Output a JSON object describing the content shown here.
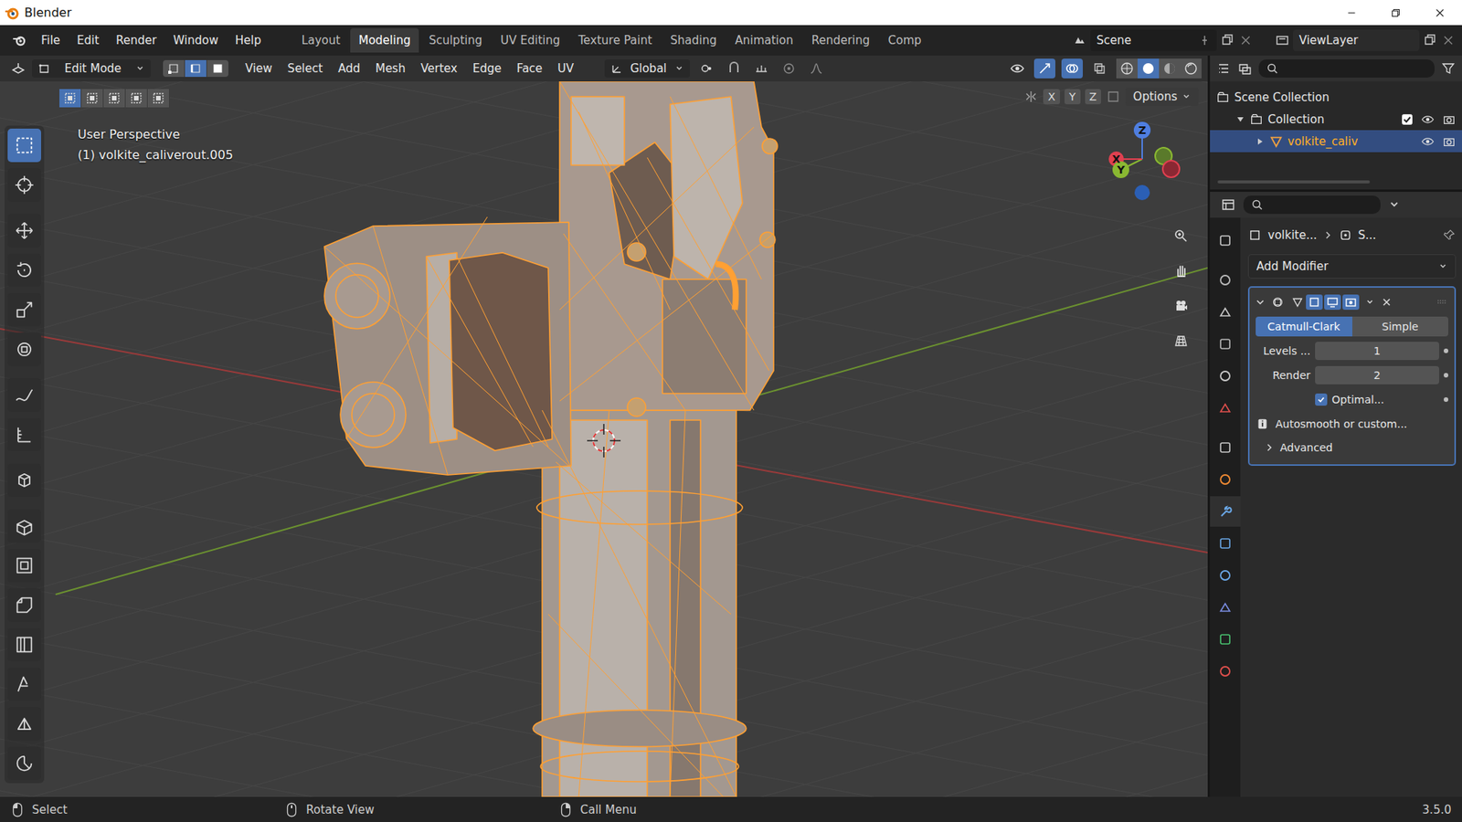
{
  "window": {
    "title": "Blender"
  },
  "menus": [
    "File",
    "Edit",
    "Render",
    "Window",
    "Help"
  ],
  "workspaces": [
    {
      "label": "Layout",
      "selected": false
    },
    {
      "label": "Modeling",
      "selected": true
    },
    {
      "label": "Sculpting",
      "selected": false
    },
    {
      "label": "UV Editing",
      "selected": false
    },
    {
      "label": "Texture Paint",
      "selected": false
    },
    {
      "label": "Shading",
      "selected": false
    },
    {
      "label": "Animation",
      "selected": false
    },
    {
      "label": "Rendering",
      "selected": false
    },
    {
      "label": "Comp",
      "selected": false
    }
  ],
  "scene": "Scene",
  "view_layer": "ViewLayer",
  "header": {
    "mode": "Edit Mode",
    "select_modes": [
      {
        "selected": false
      },
      {
        "selected": true
      },
      {
        "selected": false
      }
    ],
    "menus": [
      "View",
      "Select",
      "Add",
      "Mesh",
      "Vertex",
      "Edge",
      "Face",
      "UV"
    ],
    "orientation": "Global",
    "shading": [
      {
        "selected": false
      },
      {
        "selected": true
      },
      {
        "selected": false
      },
      {
        "selected": false
      }
    ]
  },
  "viewport": {
    "perspective": "User Perspective",
    "object": "(1) volkite_caliverout.005",
    "box_modes": [
      {
        "selected": true
      },
      {
        "selected": false
      },
      {
        "selected": false
      },
      {
        "selected": false
      },
      {
        "selected": false
      }
    ],
    "axes": [
      "X",
      "Y",
      "Z"
    ],
    "options": "Options",
    "gizmo": {
      "z": "Z",
      "y": "Y",
      "x": "X"
    }
  },
  "toolbar": [
    {
      "selected": true
    },
    {
      "selected": false
    },
    {
      "selected": false
    },
    {
      "selected": false
    },
    {
      "selected": false
    },
    {
      "selected": false
    },
    {
      "selected": false
    },
    {
      "selected": false
    },
    {
      "selected": false
    },
    {
      "selected": false
    },
    {
      "selected": false
    },
    {
      "selected": false
    },
    {
      "selected": false
    },
    {
      "selected": false
    },
    {
      "selected": false
    },
    {
      "selected": false
    }
  ],
  "outliner": {
    "items": [
      {
        "label": "Scene Collection",
        "depth": 0,
        "kind": "scene",
        "expanded": true,
        "selected": false,
        "checked": false
      },
      {
        "label": "Collection",
        "depth": 1,
        "kind": "collection",
        "expanded": true,
        "selected": false,
        "checked": true
      },
      {
        "label": "volkite_caliv",
        "depth": 2,
        "kind": "object",
        "expanded": false,
        "selected": true,
        "checked": false
      }
    ]
  },
  "properties": {
    "breadcrumb": [
      "volkite...",
      "S..."
    ],
    "tabs": [
      {
        "selected": false
      },
      {
        "selected": false
      },
      {
        "selected": false
      },
      {
        "selected": false
      },
      {
        "selected": false
      },
      {
        "selected": false
      },
      {
        "selected": false
      },
      {
        "selected": false
      },
      {
        "selected": true
      },
      {
        "selected": false
      },
      {
        "selected": false
      },
      {
        "selected": false
      },
      {
        "selected": false
      },
      {
        "selected": false
      }
    ],
    "add_modifier": "Add Modifier",
    "modifier": {
      "expanded": true,
      "types": [
        {
          "label": "Catmull-Clark",
          "selected": true
        },
        {
          "label": "Simple",
          "selected": false
        }
      ],
      "fields": [
        {
          "label": "Levels ...",
          "value": "1"
        },
        {
          "label": "Render",
          "value": "2"
        }
      ],
      "optimal": {
        "label": "Optimal...",
        "checked": true
      },
      "info": "Autosmooth or custom...",
      "advanced": {
        "label": "Advanced",
        "expanded": false
      }
    }
  },
  "status_bar": {
    "hints": [
      "Select",
      "Rotate View",
      "Call Menu"
    ],
    "version": "3.5.0"
  }
}
